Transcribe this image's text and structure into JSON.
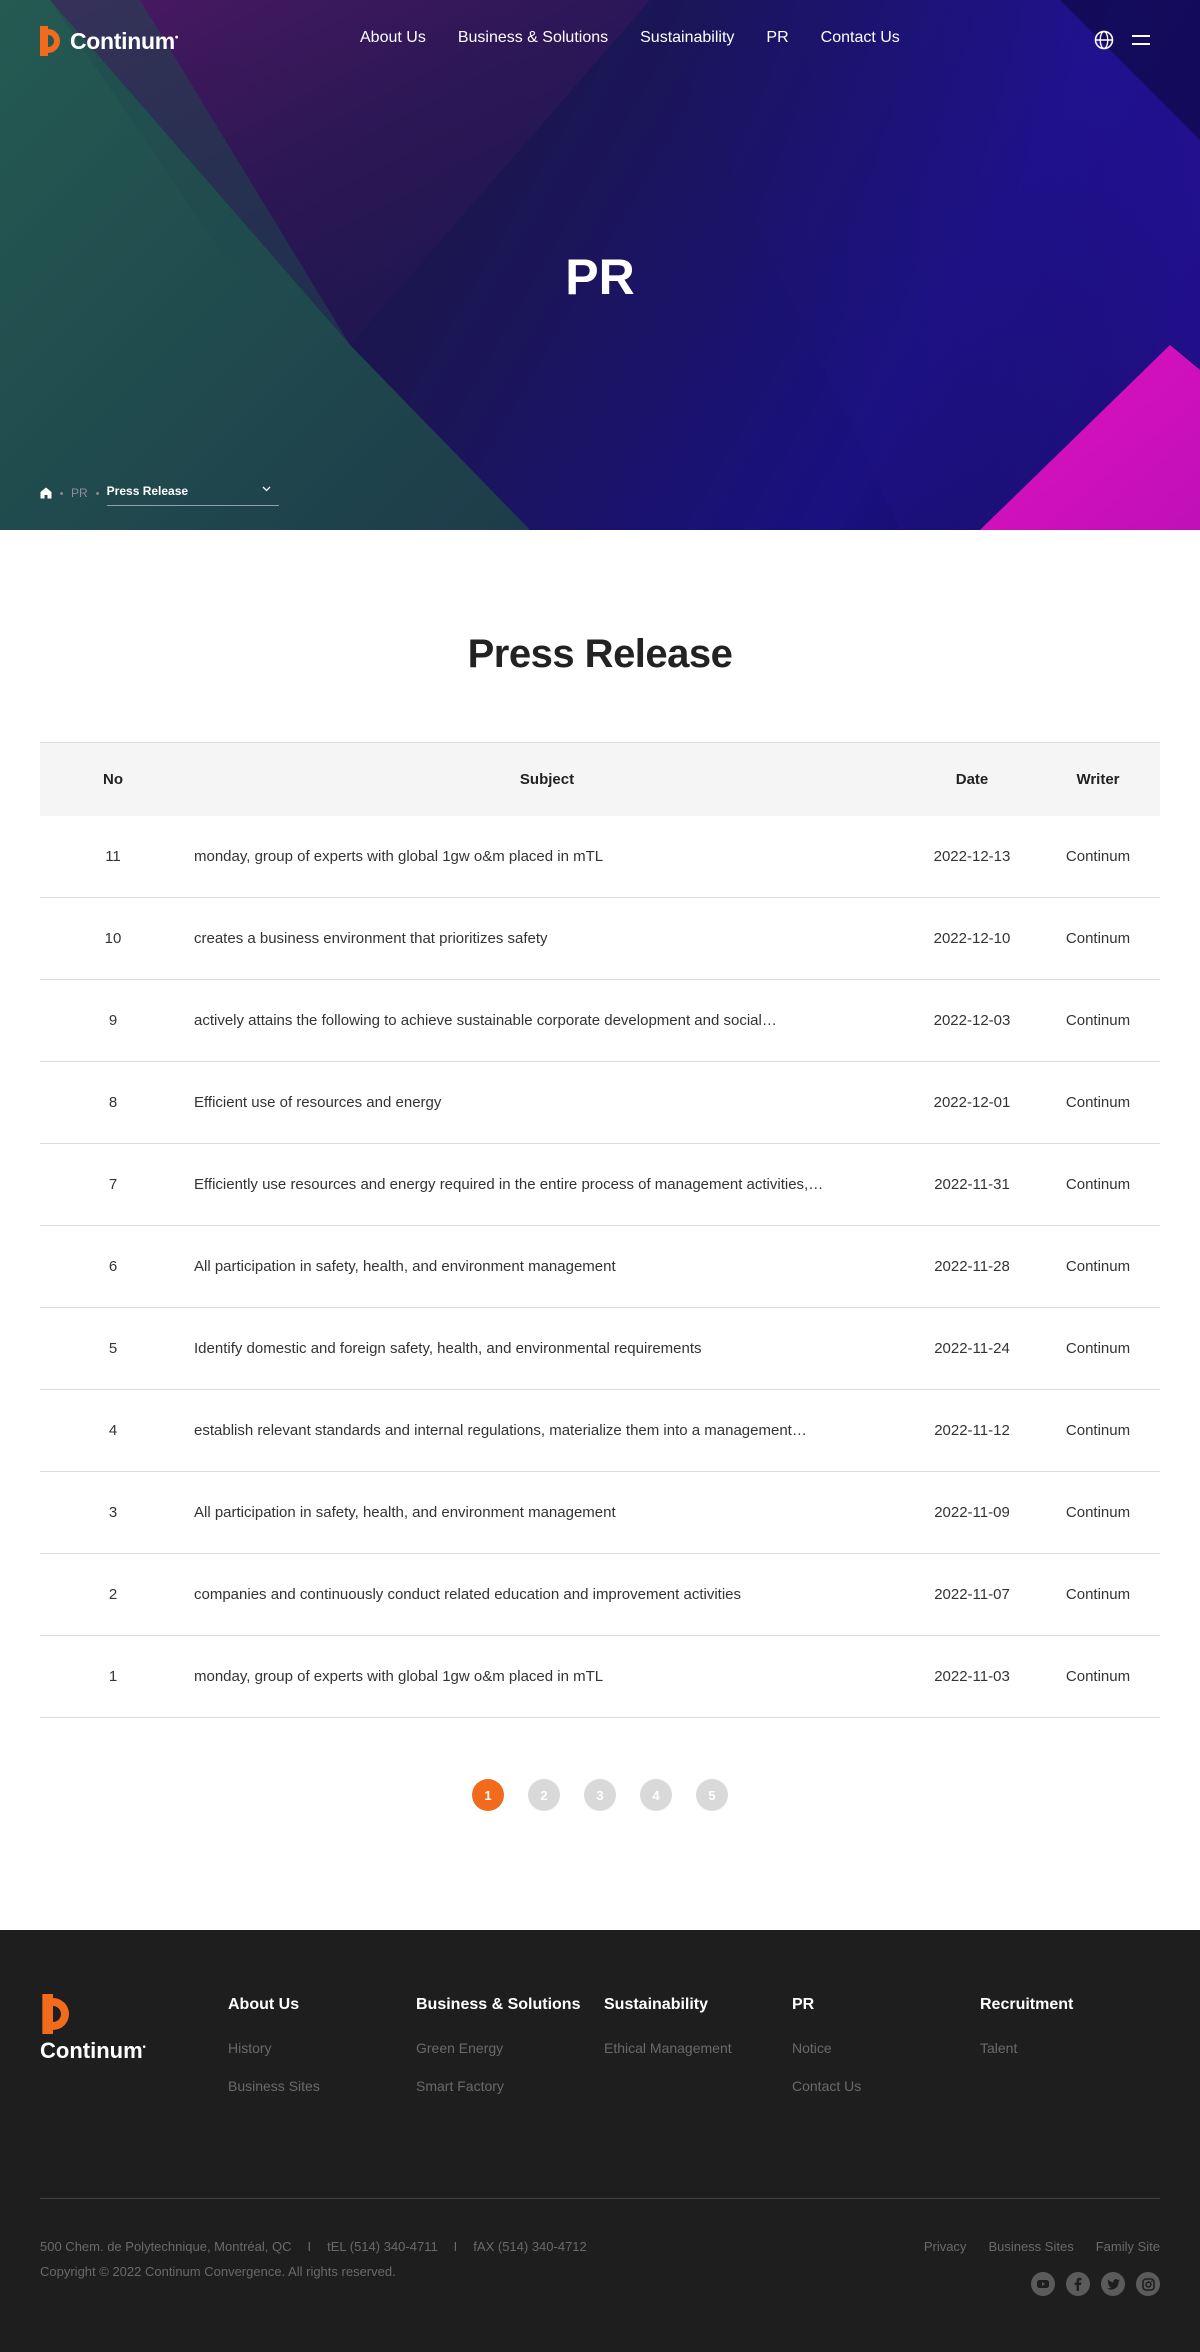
{
  "brand": {
    "name": "Continum",
    "trademark": "•",
    "accent_color": "#f26b1d",
    "logo_icon": "continum-logo-icon"
  },
  "nav": {
    "items": [
      {
        "label": "About Us"
      },
      {
        "label": "Business & Solutions"
      },
      {
        "label": "Sustainability"
      },
      {
        "label": "PR"
      },
      {
        "label": "Contact Us"
      }
    ],
    "language_icon": "globe-icon",
    "menu_icon": "hamburger-menu-icon"
  },
  "hero": {
    "title": "PR",
    "breadcrumb": {
      "home_icon": "home-icon",
      "parent": "PR",
      "current": "Press Release",
      "dropdown_icon": "chevron-down-icon"
    }
  },
  "page": {
    "title": "Press Release"
  },
  "table": {
    "headers": {
      "no": "No",
      "subject": "Subject",
      "date": "Date",
      "writer": "Writer"
    },
    "rows": [
      {
        "no": "11",
        "subject": "monday, group of experts with global 1gw o&m placed in mTL",
        "date": "2022-12-13",
        "writer": "Continum"
      },
      {
        "no": "10",
        "subject": "creates a business environment that prioritizes safety",
        "date": "2022-12-10",
        "writer": "Continum"
      },
      {
        "no": "9",
        "subject": "actively attains the following to achieve sustainable corporate development and social…",
        "date": "2022-12-03",
        "writer": "Continum"
      },
      {
        "no": "8",
        "subject": "Efficient use of resources and energy",
        "date": "2022-12-01",
        "writer": "Continum"
      },
      {
        "no": "7",
        "subject": "Efficiently use resources and energy required in the entire process of management activities,…",
        "date": "2022-11-31",
        "writer": "Continum"
      },
      {
        "no": "6",
        "subject": "All participation in safety, health, and environment management",
        "date": "2022-11-28",
        "writer": "Continum"
      },
      {
        "no": "5",
        "subject": "Identify domestic and foreign safety, health, and environmental requirements",
        "date": "2022-11-24",
        "writer": "Continum"
      },
      {
        "no": "4",
        "subject": "establish relevant standards and internal regulations, materialize them into a management…",
        "date": "2022-11-12",
        "writer": "Continum"
      },
      {
        "no": "3",
        "subject": "All participation in safety, health, and environment management",
        "date": "2022-11-09",
        "writer": "Continum"
      },
      {
        "no": "2",
        "subject": "companies and continuously conduct related education and improvement activities",
        "date": "2022-11-07",
        "writer": "Continum"
      },
      {
        "no": "1",
        "subject": "monday, group of experts with global 1gw o&m placed in mTL",
        "date": "2022-11-03",
        "writer": "Continum"
      }
    ]
  },
  "pagination": {
    "pages": [
      "1",
      "2",
      "3",
      "4",
      "5"
    ],
    "current": "1"
  },
  "footer": {
    "columns": [
      {
        "title": "About Us",
        "links": [
          "History",
          "Business Sites"
        ]
      },
      {
        "title": "Business & Solutions",
        "links": [
          "Green Energy",
          "Smart Factory"
        ]
      },
      {
        "title": "Sustainability",
        "links": [
          "Ethical Management"
        ]
      },
      {
        "title": "PR",
        "links": [
          "Notice",
          "Contact Us"
        ]
      },
      {
        "title": "Recruitment",
        "links": [
          "Talent"
        ]
      }
    ],
    "address": "500 Chem. de Polytechnique, Montréal, QC",
    "separator": "I",
    "tel": "tEL (514) 340-4711",
    "fax": "fAX (514) 340-4712",
    "copyright": "Copyright © 2022 Continum Convergence. All rights reserved.",
    "legal_links": [
      "Privacy",
      "Business Sites",
      "Family Site"
    ],
    "social": [
      "youtube-icon",
      "facebook-icon",
      "twitter-icon",
      "instagram-icon"
    ]
  }
}
